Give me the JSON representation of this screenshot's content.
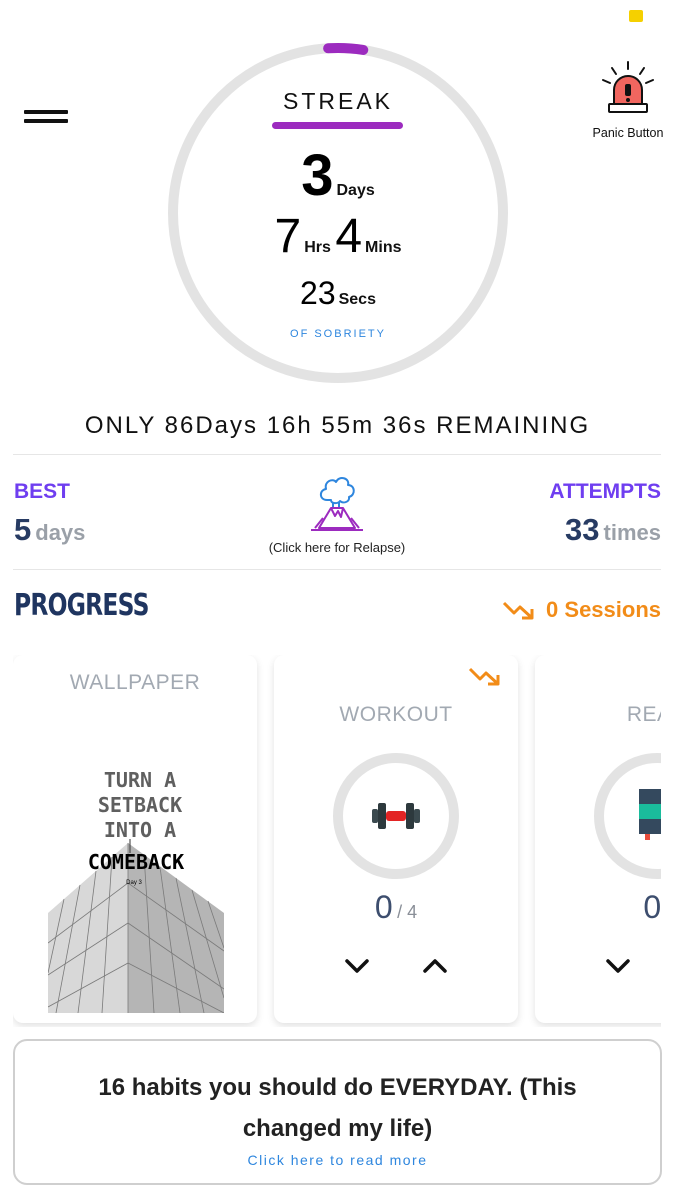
{
  "header": {
    "menu_icon": "hamburger-menu-icon",
    "panic_button": {
      "label": "Panic Button",
      "icon": "siren-alarm-icon"
    }
  },
  "streak": {
    "title": "STREAK",
    "days": "3",
    "days_unit": "Days",
    "hours": "7",
    "hours_unit": "Hrs",
    "minutes": "4",
    "minutes_unit": "Mins",
    "seconds": "23",
    "seconds_unit": "Secs",
    "subtitle": "OF SOBRIETY",
    "progress_fraction": 0.034
  },
  "remaining": "ONLY 86Days 16h 55m 36s REMAINING",
  "stats": {
    "best_label": "BEST",
    "best_value": "5",
    "best_unit": "days",
    "attempts_label": "ATTEMPTS",
    "attempts_value": "33",
    "attempts_unit": "times",
    "relapse_icon": "volcano-eruption-icon",
    "relapse_caption": "(Click here for Relapse)"
  },
  "progress": {
    "title": "PROGRESS",
    "sessions_icon": "trend-down-icon",
    "sessions_label": "0 Sessions"
  },
  "cards": [
    {
      "title": "WALLPAPER",
      "poster_lines": [
        "TURN A",
        "SETBACK",
        "INTO A",
        "COMEBACK"
      ],
      "poster_tag": "Day 3"
    },
    {
      "title": "WORKOUT",
      "icon": "dumbbell-icon",
      "count": "0",
      "goal": "/ 4"
    },
    {
      "title": "READ",
      "icon": "book-icon",
      "count": "0",
      "goal": "/"
    }
  ],
  "banner": {
    "title": "16 habits you should do EVERYDAY. (This changed my life)",
    "link": "Click here to read more"
  },
  "colors": {
    "accent_purple": "#9c2bbf",
    "stat_purple": "#6f3ef0",
    "navy": "#1f3560",
    "orange": "#f28c18",
    "link_blue": "#2e86de",
    "ring_gray": "#e3e3e3"
  }
}
